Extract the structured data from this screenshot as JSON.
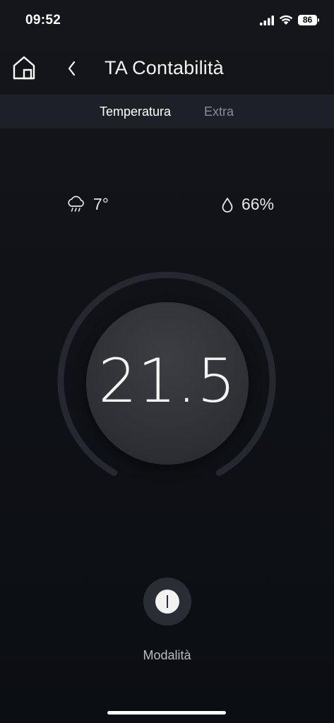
{
  "status_bar": {
    "time": "09:52",
    "battery_level": "86",
    "icons": [
      "signal-icon",
      "wifi-icon",
      "battery-icon"
    ]
  },
  "nav": {
    "title": "TA Contabilità",
    "icons": [
      "home-icon",
      "back-chevron-icon"
    ]
  },
  "tabs": [
    {
      "label": "Temperatura",
      "active": true
    },
    {
      "label": "Extra",
      "active": false
    }
  ],
  "weather": {
    "outdoor_temp": "7°",
    "humidity": "66%",
    "icons": [
      "rain-cloud-icon",
      "water-drop-icon"
    ]
  },
  "thermostat": {
    "setpoint": "21.5"
  },
  "mode": {
    "label": "Modalità",
    "icon": "mode-icon"
  },
  "colors": {
    "background": "#101218",
    "tab_bar": "#1d2026",
    "dial_track": "#25282e",
    "knob": "#2f3136",
    "text_primary": "#ffffff",
    "text_muted": "#8a8d93"
  }
}
